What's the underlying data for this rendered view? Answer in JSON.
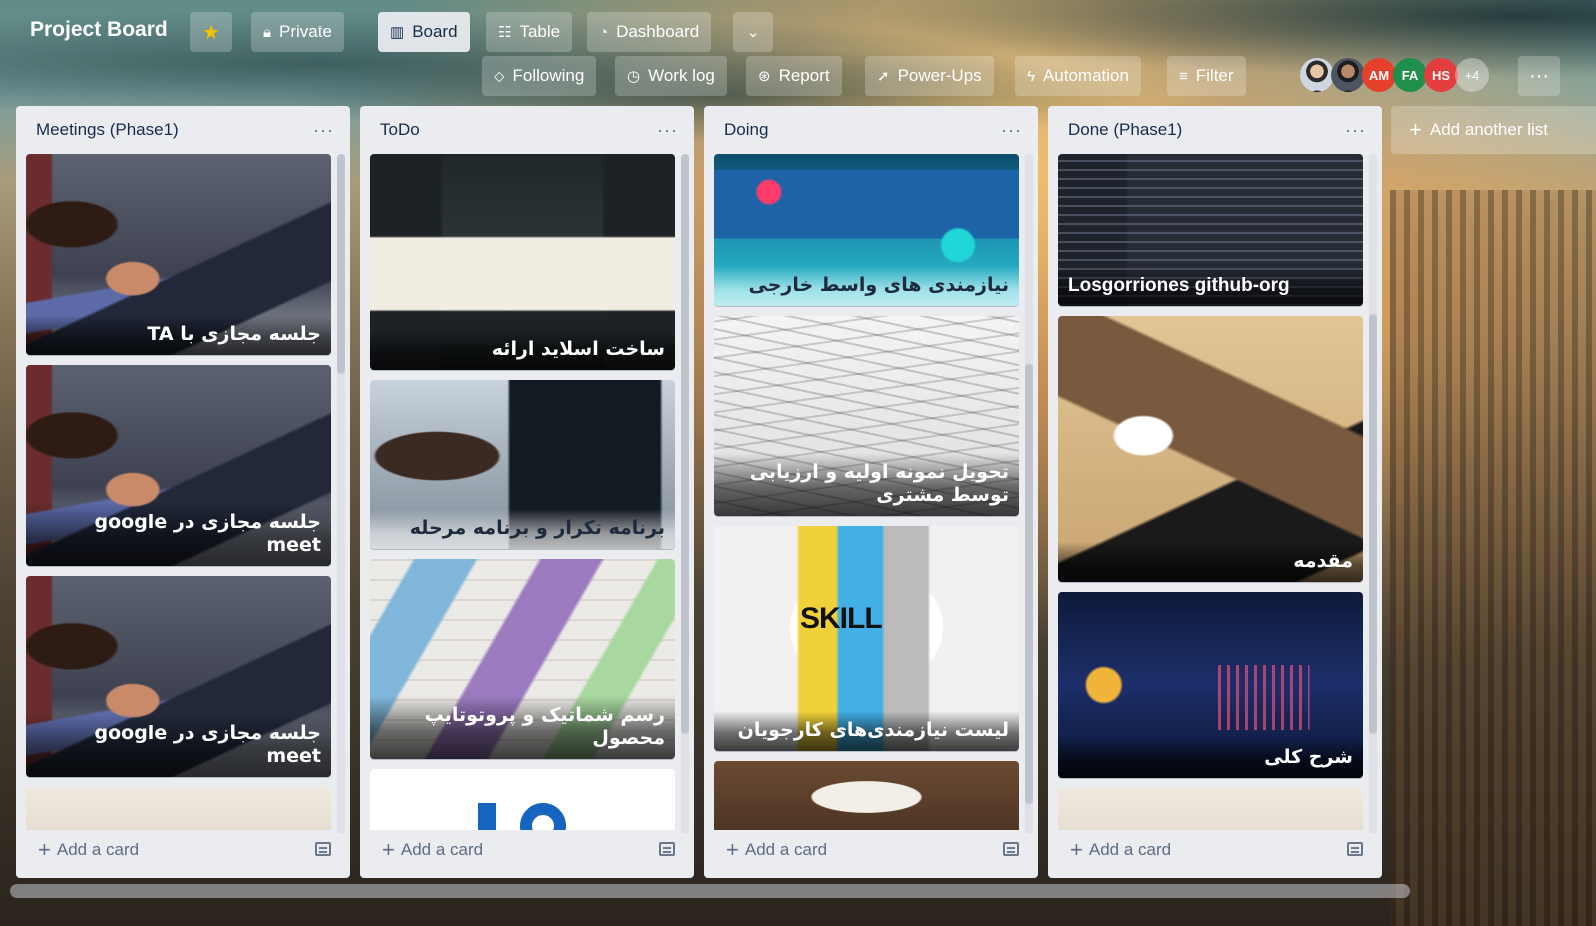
{
  "header": {
    "board_title": "Project Board",
    "private_label": "Private",
    "views": [
      "Board",
      "Table",
      "Dashboard"
    ],
    "actions": {
      "following": "Following",
      "work_log": "Work log",
      "report": "Report",
      "power_ups": "Power-Ups",
      "automation": "Automation",
      "filter": "Filter"
    },
    "avatars": [
      "AM",
      "FA",
      "HS"
    ],
    "avatar_colors": {
      "AM": "#e5412d",
      "FA": "#1f8f4b",
      "HS": "#e33d3d"
    },
    "more_members": "+4"
  },
  "lists": [
    {
      "title": "Meetings (Phase1)",
      "cards": [
        {
          "title": "جلسه مجازی با TA",
          "image": "meeting"
        },
        {
          "title": "جلسه مجازی در google meet",
          "image": "meeting"
        },
        {
          "title": "جلسه مجازی در google meet",
          "image": "meeting"
        }
      ]
    },
    {
      "title": "ToDo",
      "cards": [
        {
          "title": "ساخت اسلاید ارائه",
          "image": "stage"
        },
        {
          "title": "برنامه تکرار و برنامه مرحله",
          "image": "coder"
        },
        {
          "title": "رسم شماتیک و پروتوتایپ محصول",
          "image": "sketch"
        }
      ]
    },
    {
      "title": "Doing",
      "cards": [
        {
          "title": "نیازمندی های واسط خارجی",
          "image": "tech"
        },
        {
          "title": "تحویل نمونه اولیه و ارزیابی توسط مشتری",
          "image": "cars"
        },
        {
          "title": "لیست نیازمندی‌های کارجویان",
          "image": "skill"
        }
      ]
    },
    {
      "title": "Done (Phase1)",
      "cards": [
        {
          "title": "Losgorriones github-org",
          "image": "code"
        },
        {
          "title": "مقدمه",
          "image": "flatlay"
        },
        {
          "title": "شرح کلی",
          "image": "dashboard"
        }
      ]
    }
  ],
  "add_card_label": "Add a card",
  "add_list_label": "Add another list",
  "list_menu_glyph": "···"
}
